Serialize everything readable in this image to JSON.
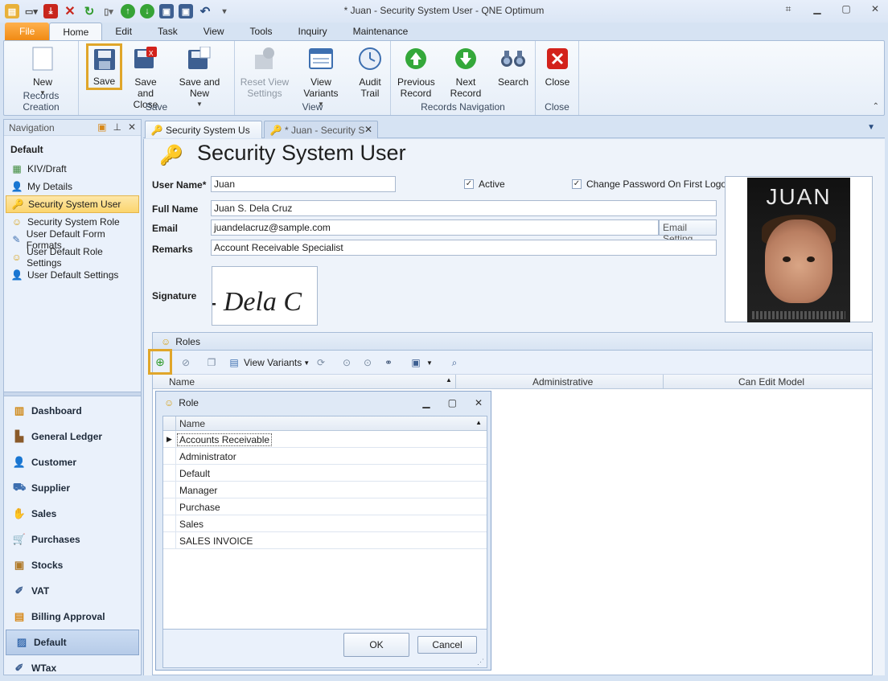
{
  "window": {
    "title": "* Juan - Security System User - QNE Optimum"
  },
  "ribbon": {
    "tabs": [
      "File",
      "Home",
      "Edit",
      "Task",
      "View",
      "Tools",
      "Inquiry",
      "Maintenance"
    ],
    "groups": {
      "records_creation": "Records Creation",
      "save": "Save",
      "view": "View",
      "records_navigation": "Records Navigation",
      "close": "Close"
    },
    "buttons": {
      "new": "New",
      "save": "Save",
      "save_and_close_1": "Save and",
      "save_and_close_2": "Close",
      "save_and_new": "Save and New",
      "reset_view_1": "Reset View",
      "reset_view_2": "Settings",
      "view_variants": "View Variants",
      "audit_trail_1": "Audit",
      "audit_trail_2": "Trail",
      "previous_1": "Previous",
      "previous_2": "Record",
      "next_record": "Next Record",
      "search": "Search",
      "close": "Close"
    }
  },
  "navigation": {
    "header": "Navigation",
    "group": "Default",
    "items": [
      {
        "label": "KIV/Draft",
        "icon": "grid-icon"
      },
      {
        "label": "My Details",
        "icon": "users-icon"
      },
      {
        "label": "Security System User",
        "icon": "user-key-icon",
        "selected": true
      },
      {
        "label": "Security System Role",
        "icon": "role-mask-icon"
      },
      {
        "label": "User Default Form Formats",
        "icon": "form-edit-icon"
      },
      {
        "label": "User Default Role Settings",
        "icon": "role-mask-icon"
      },
      {
        "label": "User Default Settings",
        "icon": "user-settings-icon"
      }
    ],
    "modules": [
      {
        "label": "Dashboard",
        "icon": "dashboard-icon"
      },
      {
        "label": "General Ledger",
        "icon": "ledger-icon"
      },
      {
        "label": "Customer",
        "icon": "customer-icon"
      },
      {
        "label": "Supplier",
        "icon": "supplier-icon"
      },
      {
        "label": "Sales",
        "icon": "sales-icon"
      },
      {
        "label": "Purchases",
        "icon": "purchases-icon"
      },
      {
        "label": "Stocks",
        "icon": "stocks-icon"
      },
      {
        "label": "VAT",
        "icon": "vat-icon"
      },
      {
        "label": "Billing Approval",
        "icon": "billing-icon"
      },
      {
        "label": "Default",
        "icon": "default-icon",
        "selected": true
      },
      {
        "label": "WTax",
        "icon": "wtax-icon"
      }
    ]
  },
  "doc_tabs": [
    {
      "label": "Security System Us"
    },
    {
      "label": "* Juan - Security S"
    }
  ],
  "form": {
    "title": "Security System User",
    "user_name_label": "User Name*",
    "user_name": "Juan",
    "active_label": "Active",
    "active_checked": true,
    "change_pw_label": "Change Password On First Logon",
    "change_pw_checked": true,
    "full_name_label": "Full Name",
    "full_name": "Juan S. Dela Cruz",
    "email_label": "Email",
    "email": "juandelacruz@sample.com",
    "email_setting": "Email Setting",
    "remarks_label": "Remarks",
    "remarks": "Account Receivable Specialist",
    "signature_label": "Signature",
    "signature_text": "- Dela C",
    "photo_title": "JUAN"
  },
  "roles": {
    "header": "Roles",
    "toolbar_view_variants": "View Variants",
    "columns": [
      "Name",
      "Administrative",
      "Can Edit Model"
    ]
  },
  "role_popup": {
    "title": "Role",
    "column": "Name",
    "rows": [
      "Accounts Receivable",
      "Administrator",
      "Default",
      "Manager",
      "Purchase",
      "Sales",
      "SALES INVOICE"
    ],
    "ok": "OK",
    "cancel": "Cancel"
  },
  "colors": {
    "highlight": "#e0a62a",
    "file_tab": "#f08a14",
    "accent": "#2a4d80"
  }
}
